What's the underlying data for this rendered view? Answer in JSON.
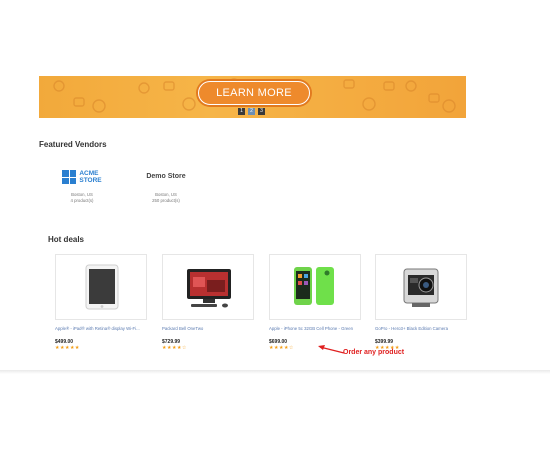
{
  "banner": {
    "button_label": "LEARN MORE",
    "slides": [
      "1",
      "2",
      "3"
    ],
    "active_slide": 2,
    "bg_color": "#f4ab3f"
  },
  "featured": {
    "title": "Featured Vendors",
    "vendors": [
      {
        "name_line1": "ACME",
        "name_line2": "STORE",
        "location": "Boston, US",
        "products": "4 product(s)"
      },
      {
        "name": "Demo Store",
        "location": "Boston, US",
        "products": "250 product(s)"
      }
    ]
  },
  "hotdeals": {
    "title": "Hot deals",
    "products": [
      {
        "name": "Apple® - iPad® with Retina® display Wi-Fi...",
        "price": "$499.00",
        "rating": 5,
        "image": "ipad-icon"
      },
      {
        "name": "Packard Bell OneTwo",
        "price": "$729.99",
        "rating": 4.5,
        "image": "all-in-one-pc-icon"
      },
      {
        "name": "Apple - iPhone 5c 32GB Cell Phone - Green",
        "price": "$699.00",
        "rating": 4.5,
        "image": "iphone-icon"
      },
      {
        "name": "GoPro - Hero3+ Black Edition Camera",
        "price": "$399.99",
        "rating": 5,
        "image": "gopro-camera-icon"
      }
    ]
  },
  "annotation": {
    "text": "Order any product",
    "color": "#e02020"
  },
  "stars": {
    "five": "★★★★★",
    "four_half": "★★★★☆"
  }
}
